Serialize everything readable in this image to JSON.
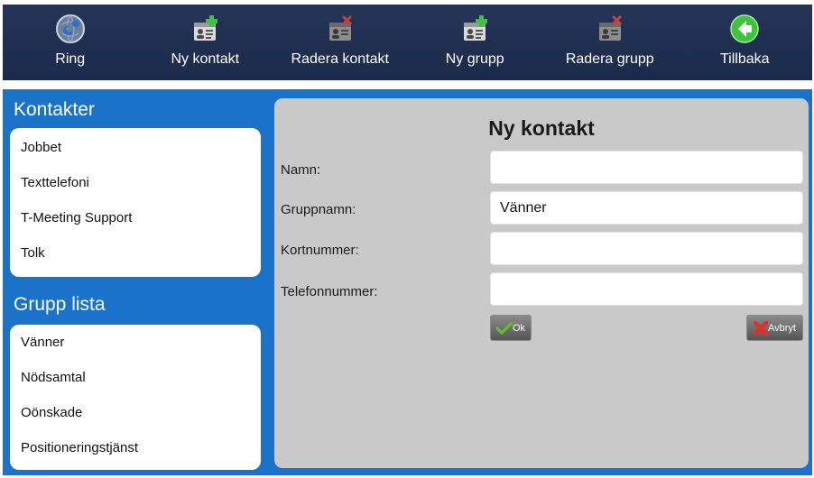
{
  "toolbar": {
    "items": [
      {
        "label": "Ring",
        "icon": "phone-globe-icon"
      },
      {
        "label": "Ny kontakt",
        "icon": "add-contact-icon"
      },
      {
        "label": "Radera kontakt",
        "icon": "delete-contact-icon"
      },
      {
        "label": "Ny grupp",
        "icon": "add-group-icon"
      },
      {
        "label": "Radera grupp",
        "icon": "delete-group-icon"
      },
      {
        "label": "Tillbaka",
        "icon": "back-arrow-icon"
      }
    ]
  },
  "contacts": {
    "title": "Kontakter",
    "items": [
      "Jobbet",
      "Texttelefoni",
      "T-Meeting Support",
      "Tolk"
    ]
  },
  "groups": {
    "title": "Grupp lista",
    "items": [
      "Vänner",
      "Nödsamtal",
      "Oönskade",
      "Positioneringstjänst"
    ]
  },
  "form": {
    "title": "Ny kontakt",
    "name_label": "Namn:",
    "name_value": "",
    "group_label": "Gruppnamn:",
    "group_value": "Vänner",
    "short_label": "Kortnummer:",
    "short_value": "",
    "phone_label": "Telefonnummer:",
    "phone_value": "",
    "ok_label": "Ok",
    "cancel_label": "Avbryt"
  },
  "colors": {
    "toolbar_bg": "#1f2e50",
    "panel_bg": "#1a73c9",
    "form_bg": "#c9c9c9",
    "ok_check": "#5fbf2a",
    "cancel_x": "#e0302a",
    "add_plus": "#3fc23f"
  }
}
